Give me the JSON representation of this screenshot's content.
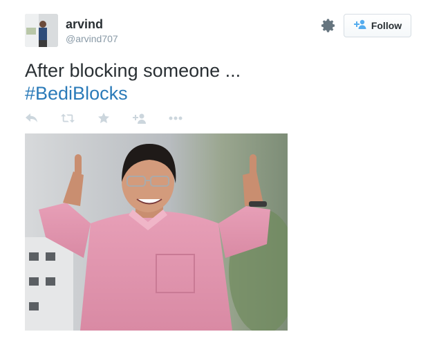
{
  "user": {
    "display_name": "arvind",
    "handle": "@arvind707"
  },
  "header": {
    "follow_label": "Follow",
    "settings_icon": "gear-icon",
    "follow_icon": "add-user-icon"
  },
  "tweet": {
    "text": "After blocking someone ...",
    "hashtag": "#BediBlocks"
  },
  "actions": [
    {
      "name": "reply-icon"
    },
    {
      "name": "retweet-icon"
    },
    {
      "name": "favorite-icon"
    },
    {
      "name": "follow-icon"
    },
    {
      "name": "more-icon"
    }
  ],
  "colors": {
    "hashtag": "#2b7bb9",
    "muted": "#8899a6",
    "icon": "#ccd6dd",
    "follow_icon": "#55acee"
  }
}
